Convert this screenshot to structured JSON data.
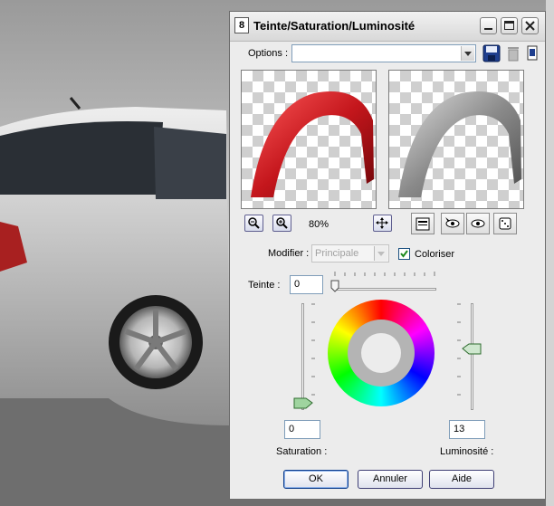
{
  "window": {
    "title": "Teinte/Saturation/Luminosité",
    "app_icon": "8"
  },
  "options": {
    "label": "Options :",
    "value": ""
  },
  "preview": {
    "zoom": "80%"
  },
  "modifier": {
    "label": "Modifier :",
    "value": "Principale",
    "colorize_label": "Coloriser",
    "colorize_checked": true
  },
  "hue": {
    "label": "Teinte :",
    "value": "0"
  },
  "saturation": {
    "label": "Saturation :",
    "value": "0"
  },
  "luminosity": {
    "label": "Luminosité :",
    "value": "13"
  },
  "buttons": {
    "ok": "OK",
    "cancel": "Annuler",
    "help": "Aide"
  },
  "colors": {
    "accent": "#0b3a8a",
    "preview_left": "#c4161c",
    "preview_right": "#8a8a8a"
  }
}
